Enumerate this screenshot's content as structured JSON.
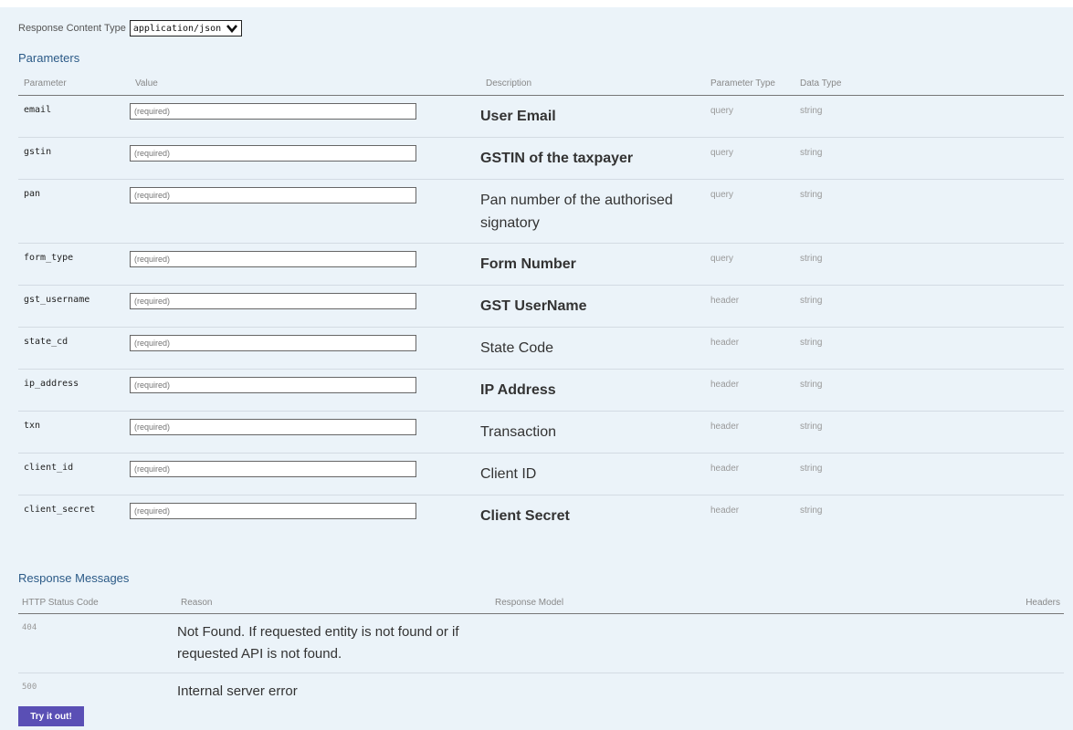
{
  "response_content_type": {
    "label": "Response Content Type",
    "selected": "application/json"
  },
  "parameters": {
    "title": "Parameters",
    "headers": [
      "Parameter",
      "Value",
      "Description",
      "Parameter Type",
      "Data Type"
    ],
    "rows": [
      {
        "name": "email",
        "placeholder": "(required)",
        "description": "User Email",
        "param_type": "query",
        "data_type": "string"
      },
      {
        "name": "gstin",
        "placeholder": "(required)",
        "description": "GSTIN of the taxpayer",
        "param_type": "query",
        "data_type": "string"
      },
      {
        "name": "pan",
        "placeholder": "(required)",
        "description": "Pan number of the authorised signatory",
        "param_type": "query",
        "data_type": "string"
      },
      {
        "name": "form_type",
        "placeholder": "(required)",
        "description": "Form Number",
        "param_type": "query",
        "data_type": "string"
      },
      {
        "name": "gst_username",
        "placeholder": "(required)",
        "description": "GST UserName",
        "param_type": "header",
        "data_type": "string"
      },
      {
        "name": "state_cd",
        "placeholder": "(required)",
        "description": "State Code",
        "param_type": "header",
        "data_type": "string"
      },
      {
        "name": "ip_address",
        "placeholder": "(required)",
        "description": "IP Address",
        "param_type": "header",
        "data_type": "string"
      },
      {
        "name": "txn",
        "placeholder": "(required)",
        "description": "Transaction",
        "param_type": "header",
        "data_type": "string"
      },
      {
        "name": "client_id",
        "placeholder": "(required)",
        "description": "Client ID",
        "param_type": "header",
        "data_type": "string"
      },
      {
        "name": "client_secret",
        "placeholder": "(required)",
        "description": "Client Secret",
        "param_type": "header",
        "data_type": "string"
      }
    ]
  },
  "response_messages": {
    "title": "Response Messages",
    "headers": [
      "HTTP Status Code",
      "Reason",
      "Response Model",
      "Headers"
    ],
    "rows": [
      {
        "code": "404",
        "reason": "Not Found. If requested entity is not found or if requested API is not found."
      },
      {
        "code": "500",
        "reason": "Internal server error"
      }
    ]
  },
  "try_button": "Try it out!",
  "colors": {
    "accent": "#5a4fb5",
    "section_title": "#2b5a87",
    "background": "#ebf3f9"
  }
}
